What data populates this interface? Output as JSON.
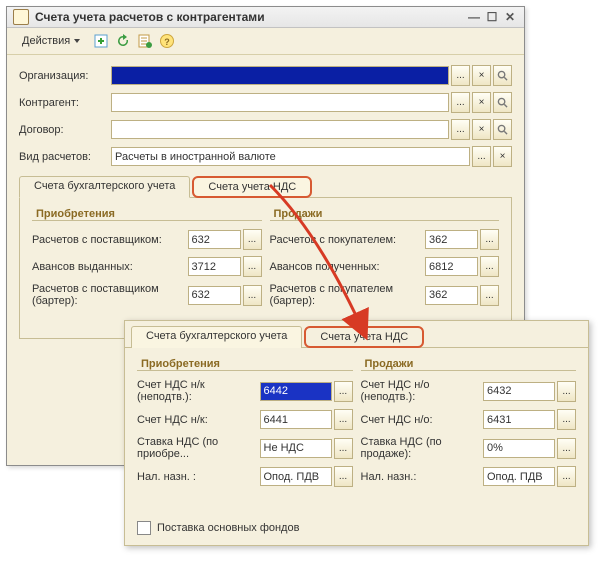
{
  "window": {
    "title": "Счета учета расчетов с контрагентами"
  },
  "toolbar": {
    "actions_label": "Действия"
  },
  "form": {
    "org_label": "Организация:",
    "contragent_label": "Контрагент:",
    "contract_label": "Договор:",
    "calc_type_label": "Вид расчетов:",
    "calc_type_value": "Расчеты в иностранной валюте",
    "ellipsis": "...",
    "clear": "×"
  },
  "tabs1": {
    "acc": "Счета бухгалтерского учета",
    "vat": "Счета учета НДС"
  },
  "acquisitions": {
    "legend": "Приобретения",
    "supplier": "Расчетов с поставщиком:",
    "supplier_val": "632",
    "advances_issued": "Авансов выданных:",
    "advances_issued_val": "3712",
    "supplier_barter": "Расчетов с поставщиком (бартер):",
    "supplier_barter_val": "632"
  },
  "sales": {
    "legend": "Продажи",
    "buyer": "Расчетов с покупателем:",
    "buyer_val": "362",
    "advances_recv": "Авансов полученных:",
    "advances_recv_val": "6812",
    "buyer_barter": "Расчетов с покупателем (бартер):",
    "buyer_barter_val": "362"
  },
  "tabs2": {
    "acc": "Счета бухгалтерского учета",
    "vat": "Счета учета НДС"
  },
  "vat_acq": {
    "legend": "Приобретения",
    "nk_unconf": "Счет НДС н/к (неподтв.):",
    "nk_unconf_val": "6442",
    "nk": "Счет НДС н/к:",
    "nk_val": "6441",
    "rate_acq": "Ставка НДС (по приобре...",
    "rate_acq_val": "Не НДС",
    "nal_label": "Нал. назн. :",
    "nal_val": "Опод. ПДВ"
  },
  "vat_sales": {
    "legend": "Продажи",
    "no_unconf": "Счет НДС н/о (неподтв.):",
    "no_unconf_val": "6432",
    "no": "Счет НДС н/о:",
    "no_val": "6431",
    "rate_sales": "Ставка НДС (по продаже):",
    "rate_sales_val": "0%",
    "nal_label": "Нал. назн.:",
    "nal_val": "Опод. ПДВ"
  },
  "checkbox": {
    "fixed_assets": "Поставка основных фондов"
  }
}
